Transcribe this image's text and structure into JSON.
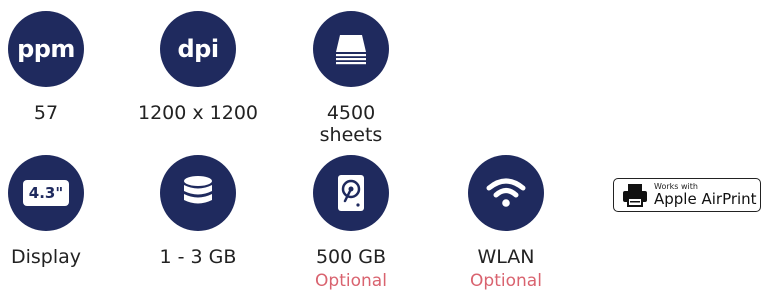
{
  "colors": {
    "circle": "#1f2a5e",
    "optional": "#d9636f"
  },
  "features": [
    {
      "icon_name": "ppm-badge",
      "icon_text": "ppm",
      "label": "57"
    },
    {
      "icon_name": "dpi-badge",
      "icon_text": "dpi",
      "label": "1200 x 1200"
    },
    {
      "icon_name": "paper-stack-icon",
      "label": "4500",
      "label2": "sheets"
    },
    {
      "icon_name": "screen-icon",
      "icon_text": "4.3\"",
      "label": "Display"
    },
    {
      "icon_name": "database-icon",
      "label": "1 - 3 GB"
    },
    {
      "icon_name": "hard-drive-icon",
      "label": "500 GB",
      "optional": "Optional"
    },
    {
      "icon_name": "wifi-icon",
      "label": "WLAN",
      "optional": "Optional"
    }
  ],
  "airprint": {
    "small": "Works with",
    "big": "Apple AirPrint"
  }
}
